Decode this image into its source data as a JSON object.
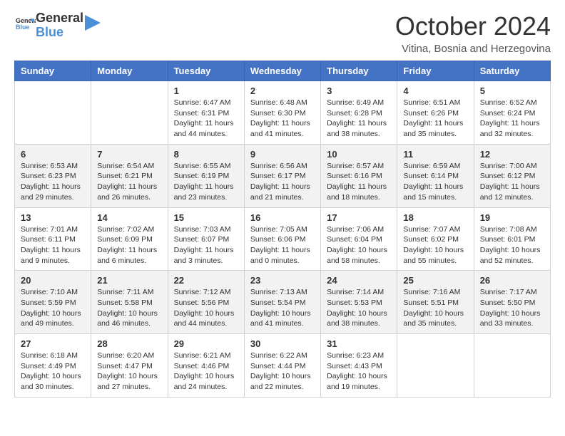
{
  "header": {
    "logo_general": "General",
    "logo_blue": "Blue",
    "month_title": "October 2024",
    "subtitle": "Vitina, Bosnia and Herzegovina"
  },
  "calendar": {
    "days": [
      "Sunday",
      "Monday",
      "Tuesday",
      "Wednesday",
      "Thursday",
      "Friday",
      "Saturday"
    ],
    "weeks": [
      [
        {
          "day": "",
          "content": ""
        },
        {
          "day": "",
          "content": ""
        },
        {
          "day": "1",
          "content": "Sunrise: 6:47 AM\nSunset: 6:31 PM\nDaylight: 11 hours and 44 minutes."
        },
        {
          "day": "2",
          "content": "Sunrise: 6:48 AM\nSunset: 6:30 PM\nDaylight: 11 hours and 41 minutes."
        },
        {
          "day": "3",
          "content": "Sunrise: 6:49 AM\nSunset: 6:28 PM\nDaylight: 11 hours and 38 minutes."
        },
        {
          "day": "4",
          "content": "Sunrise: 6:51 AM\nSunset: 6:26 PM\nDaylight: 11 hours and 35 minutes."
        },
        {
          "day": "5",
          "content": "Sunrise: 6:52 AM\nSunset: 6:24 PM\nDaylight: 11 hours and 32 minutes."
        }
      ],
      [
        {
          "day": "6",
          "content": "Sunrise: 6:53 AM\nSunset: 6:23 PM\nDaylight: 11 hours and 29 minutes."
        },
        {
          "day": "7",
          "content": "Sunrise: 6:54 AM\nSunset: 6:21 PM\nDaylight: 11 hours and 26 minutes."
        },
        {
          "day": "8",
          "content": "Sunrise: 6:55 AM\nSunset: 6:19 PM\nDaylight: 11 hours and 23 minutes."
        },
        {
          "day": "9",
          "content": "Sunrise: 6:56 AM\nSunset: 6:17 PM\nDaylight: 11 hours and 21 minutes."
        },
        {
          "day": "10",
          "content": "Sunrise: 6:57 AM\nSunset: 6:16 PM\nDaylight: 11 hours and 18 minutes."
        },
        {
          "day": "11",
          "content": "Sunrise: 6:59 AM\nSunset: 6:14 PM\nDaylight: 11 hours and 15 minutes."
        },
        {
          "day": "12",
          "content": "Sunrise: 7:00 AM\nSunset: 6:12 PM\nDaylight: 11 hours and 12 minutes."
        }
      ],
      [
        {
          "day": "13",
          "content": "Sunrise: 7:01 AM\nSunset: 6:11 PM\nDaylight: 11 hours and 9 minutes."
        },
        {
          "day": "14",
          "content": "Sunrise: 7:02 AM\nSunset: 6:09 PM\nDaylight: 11 hours and 6 minutes."
        },
        {
          "day": "15",
          "content": "Sunrise: 7:03 AM\nSunset: 6:07 PM\nDaylight: 11 hours and 3 minutes."
        },
        {
          "day": "16",
          "content": "Sunrise: 7:05 AM\nSunset: 6:06 PM\nDaylight: 11 hours and 0 minutes."
        },
        {
          "day": "17",
          "content": "Sunrise: 7:06 AM\nSunset: 6:04 PM\nDaylight: 10 hours and 58 minutes."
        },
        {
          "day": "18",
          "content": "Sunrise: 7:07 AM\nSunset: 6:02 PM\nDaylight: 10 hours and 55 minutes."
        },
        {
          "day": "19",
          "content": "Sunrise: 7:08 AM\nSunset: 6:01 PM\nDaylight: 10 hours and 52 minutes."
        }
      ],
      [
        {
          "day": "20",
          "content": "Sunrise: 7:10 AM\nSunset: 5:59 PM\nDaylight: 10 hours and 49 minutes."
        },
        {
          "day": "21",
          "content": "Sunrise: 7:11 AM\nSunset: 5:58 PM\nDaylight: 10 hours and 46 minutes."
        },
        {
          "day": "22",
          "content": "Sunrise: 7:12 AM\nSunset: 5:56 PM\nDaylight: 10 hours and 44 minutes."
        },
        {
          "day": "23",
          "content": "Sunrise: 7:13 AM\nSunset: 5:54 PM\nDaylight: 10 hours and 41 minutes."
        },
        {
          "day": "24",
          "content": "Sunrise: 7:14 AM\nSunset: 5:53 PM\nDaylight: 10 hours and 38 minutes."
        },
        {
          "day": "25",
          "content": "Sunrise: 7:16 AM\nSunset: 5:51 PM\nDaylight: 10 hours and 35 minutes."
        },
        {
          "day": "26",
          "content": "Sunrise: 7:17 AM\nSunset: 5:50 PM\nDaylight: 10 hours and 33 minutes."
        }
      ],
      [
        {
          "day": "27",
          "content": "Sunrise: 6:18 AM\nSunset: 4:49 PM\nDaylight: 10 hours and 30 minutes."
        },
        {
          "day": "28",
          "content": "Sunrise: 6:20 AM\nSunset: 4:47 PM\nDaylight: 10 hours and 27 minutes."
        },
        {
          "day": "29",
          "content": "Sunrise: 6:21 AM\nSunset: 4:46 PM\nDaylight: 10 hours and 24 minutes."
        },
        {
          "day": "30",
          "content": "Sunrise: 6:22 AM\nSunset: 4:44 PM\nDaylight: 10 hours and 22 minutes."
        },
        {
          "day": "31",
          "content": "Sunrise: 6:23 AM\nSunset: 4:43 PM\nDaylight: 10 hours and 19 minutes."
        },
        {
          "day": "",
          "content": ""
        },
        {
          "day": "",
          "content": ""
        }
      ]
    ]
  }
}
